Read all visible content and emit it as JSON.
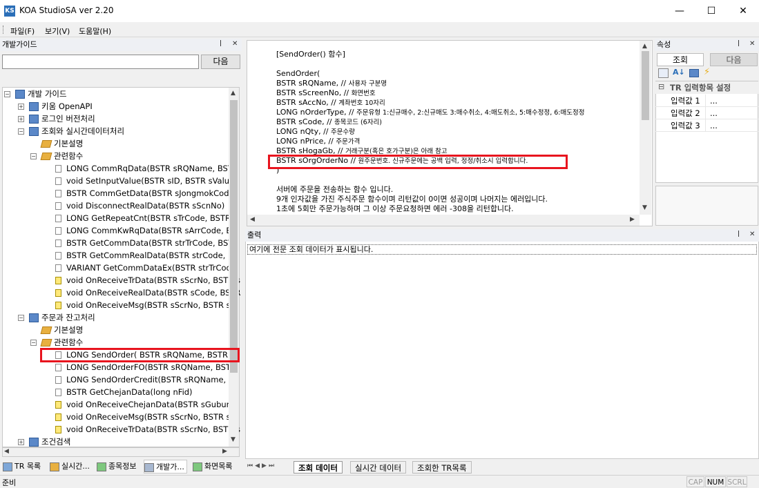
{
  "window": {
    "title": "KOA StudioSA ver 2.20",
    "icon_text": "KS",
    "minimize": "—",
    "maximize": "☐",
    "close": "✕"
  },
  "menu": [
    {
      "label": "파일(F)"
    },
    {
      "label": "보기(V)"
    },
    {
      "label": "도움말(H)"
    }
  ],
  "left_panel": {
    "title": "개발가이드",
    "search_placeholder": "",
    "next_button": "다음",
    "tree": [
      {
        "label": "개발 가이드",
        "type": "book"
      },
      {
        "label": "키움 OpenAPI",
        "type": "book"
      },
      {
        "label": "로그인 버전처리",
        "type": "book"
      },
      {
        "label": "조회와 실시간데이터처리",
        "type": "book"
      },
      {
        "label": "기본설명",
        "type": "tag"
      },
      {
        "label": "관련함수",
        "type": "tag"
      },
      {
        "label": "LONG CommRqData(BSTR sRQName, BSTR",
        "type": "doc"
      },
      {
        "label": "void SetInputValue(BSTR sID, BSTR sValue)",
        "type": "doc"
      },
      {
        "label": "BSTR CommGetData(BSTR sJongmokCode,",
        "type": "doc"
      },
      {
        "label": "void DisconnectRealData(BSTR sScnNo)",
        "type": "doc"
      },
      {
        "label": "LONG GetRepeatCnt(BSTR sTrCode, BSTR s",
        "type": "doc"
      },
      {
        "label": "LONG CommKwRqData(BSTR sArrCode, BO",
        "type": "doc"
      },
      {
        "label": "BSTR GetCommData(BSTR strTrCode, BSTR",
        "type": "doc"
      },
      {
        "label": "BSTR GetCommRealData(BSTR strCode, lor",
        "type": "doc"
      },
      {
        "label": "VARIANT GetCommDataEx(BSTR strTrCode",
        "type": "doc"
      },
      {
        "label": "void OnReceiveTrData(BSTR sScrNo, BSTR s",
        "type": "event"
      },
      {
        "label": "void OnReceiveRealData(BSTR sCode, BSTR",
        "type": "event"
      },
      {
        "label": "void OnReceiveMsg(BSTR sScrNo, BSTR sR(",
        "type": "event"
      },
      {
        "label": "주문과 잔고처리",
        "type": "book"
      },
      {
        "label": "기본설명",
        "type": "tag"
      },
      {
        "label": "관련함수",
        "type": "tag"
      },
      {
        "label": "LONG SendOrder( BSTR sRQName, BSTR s",
        "type": "doc"
      },
      {
        "label": "LONG SendOrderFO(BSTR sRQName, BSTR",
        "type": "doc"
      },
      {
        "label": "LONG SendOrderCredit(BSTR sRQName, BS",
        "type": "doc"
      },
      {
        "label": "BSTR GetChejanData(long nFid)",
        "type": "doc"
      },
      {
        "label": "void OnReceiveChejanData(BSTR sGubun, l",
        "type": "event"
      },
      {
        "label": "void OnReceiveMsg(BSTR sScrNo, BSTR sR(",
        "type": "event"
      },
      {
        "label": "void OnReceiveTrData(BSTR sScrNo, BSTR s",
        "type": "event"
      },
      {
        "label": "조건검색",
        "type": "book"
      }
    ],
    "bottom_tabs": [
      {
        "label": "TR 목록"
      },
      {
        "label": "실시간..."
      },
      {
        "label": "종목정보"
      },
      {
        "label": "개발가..."
      },
      {
        "label": "화면목록"
      }
    ]
  },
  "doc": {
    "lines": [
      {
        "code": "[SendOrder() 함수]",
        "comment": ""
      },
      {
        "code": "",
        "comment": ""
      },
      {
        "code": "SendOrder(",
        "comment": ""
      },
      {
        "code": "BSTR sRQName, // ",
        "comment": "사용자 구분명"
      },
      {
        "code": "BSTR sScreenNo, // ",
        "comment": "화면번호"
      },
      {
        "code": "BSTR sAccNo,  // ",
        "comment": "계좌번호 10자리"
      },
      {
        "code": "LONG nOrderType,  // ",
        "comment": "주문유형 1:신규매수, 2:신규매도 3:매수취소, 4:매도취소, 5:매수정정, 6:매도정정"
      },
      {
        "code": "BSTR sCode, // ",
        "comment": "종목코드 (6자리)"
      },
      {
        "code": "LONG nQty,  // ",
        "comment": "주문수량"
      },
      {
        "code": "LONG nPrice, // ",
        "comment": "주문가격"
      },
      {
        "code": "BSTR sHogaGb,   // ",
        "comment": "거래구분(혹은 호가구분)은 아래 참고"
      },
      {
        "code": "BSTR sOrgOrderNo  // ",
        "comment": "원주문번호. 신규주문에는 공백 입력, 정정/취소시 입력합니다."
      },
      {
        "code": ")",
        "comment": ""
      },
      {
        "code": "",
        "comment": ""
      },
      {
        "code": "서버에 주문을 전송하는 함수 입니다.",
        "comment": ""
      },
      {
        "code": "9개 인자값을 가진 주식주문 함수이며 리턴값이 0이면 성공이며 나머지는 에러입니다.",
        "comment": ""
      },
      {
        "code": "1초에 5회만 주문가능하며 그 이상 주문요청하면 에러 -308을 리턴합니다.",
        "comment": ""
      }
    ]
  },
  "properties": {
    "title": "속성",
    "tab_query": "조회",
    "tab_next": "다음",
    "category": "TR 입력항목 설정",
    "rows": [
      {
        "name": "입력값 1",
        "value": "..."
      },
      {
        "name": "입력값 2",
        "value": "..."
      },
      {
        "name": "입력값 3",
        "value": "..."
      }
    ]
  },
  "output": {
    "title": "출력",
    "message": "여기에 전문 조회 데이터가 표시됩니다.",
    "tabs": [
      {
        "label": "조회 데이터"
      },
      {
        "label": "실시간 데이터"
      },
      {
        "label": "조회한 TR목록"
      }
    ]
  },
  "status": {
    "text": "준비",
    "cap": "CAP",
    "num": "NUM",
    "scrl": "SCRL"
  },
  "colors": {
    "highlight": "#e8141e",
    "accent": "#2b6fb8"
  }
}
